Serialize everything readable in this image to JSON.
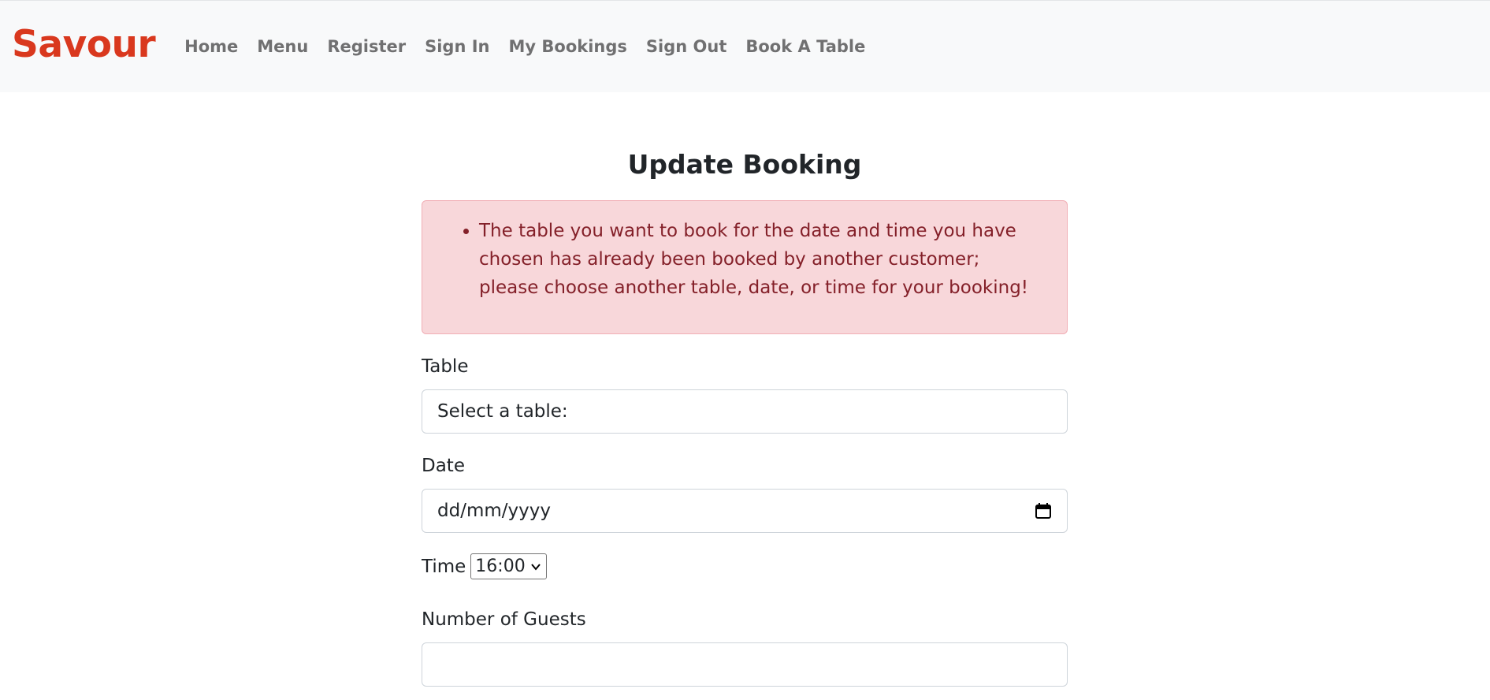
{
  "navbar": {
    "brand": "Savour",
    "links": [
      "Home",
      "Menu",
      "Register",
      "Sign In",
      "My Bookings",
      "Sign Out",
      "Book A Table"
    ]
  },
  "page": {
    "title": "Update Booking"
  },
  "alert": {
    "message": "The table you want to book for the date and time you have chosen has already been booked by another customer; please choose another table, date, or time for your booking!"
  },
  "form": {
    "table_label": "Table",
    "table_selected": "Select a table:",
    "date_label": "Date",
    "date_placeholder": "dd/mm/yyyy",
    "time_label": "Time",
    "time_selected": "16:00",
    "guests_label": "Number of Guests",
    "guests_value": ""
  },
  "colors": {
    "brand": "#d9381e",
    "alert_bg": "#f8d7da",
    "alert_text": "#842029",
    "navbar_bg": "#f8f9fa"
  }
}
